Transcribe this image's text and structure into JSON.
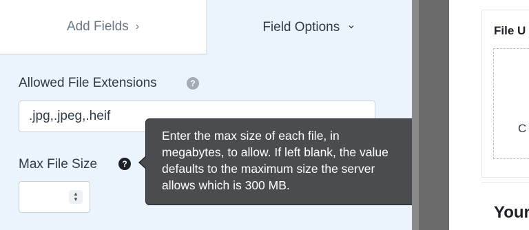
{
  "tabs": {
    "add_fields": "Add Fields",
    "add_fields_chevron": "›",
    "field_options": "Field Options",
    "field_options_chevron": "⌄"
  },
  "fields": {
    "allowed_extensions_label": "Allowed File Extensions",
    "allowed_extensions_value": ".jpg,.jpeg,.heif",
    "max_file_size_label": "Max File Size",
    "max_file_size_value": ""
  },
  "help_icons": {
    "grey": "?",
    "dark": "?"
  },
  "tooltip": {
    "lines": [
      "Enter the max size of each file, in",
      "megabytes, to allow. If left blank, the value",
      "defaults to the maximum size the server",
      "allows which is 300 MB."
    ]
  },
  "preview": {
    "field_title": "File U",
    "dropzone_text": "C",
    "heading": "Your"
  },
  "colors": {
    "panel_bg": "#ebf3fc",
    "tooltip_bg": "#4a4c4f",
    "gutter": "#6b6b6b"
  }
}
